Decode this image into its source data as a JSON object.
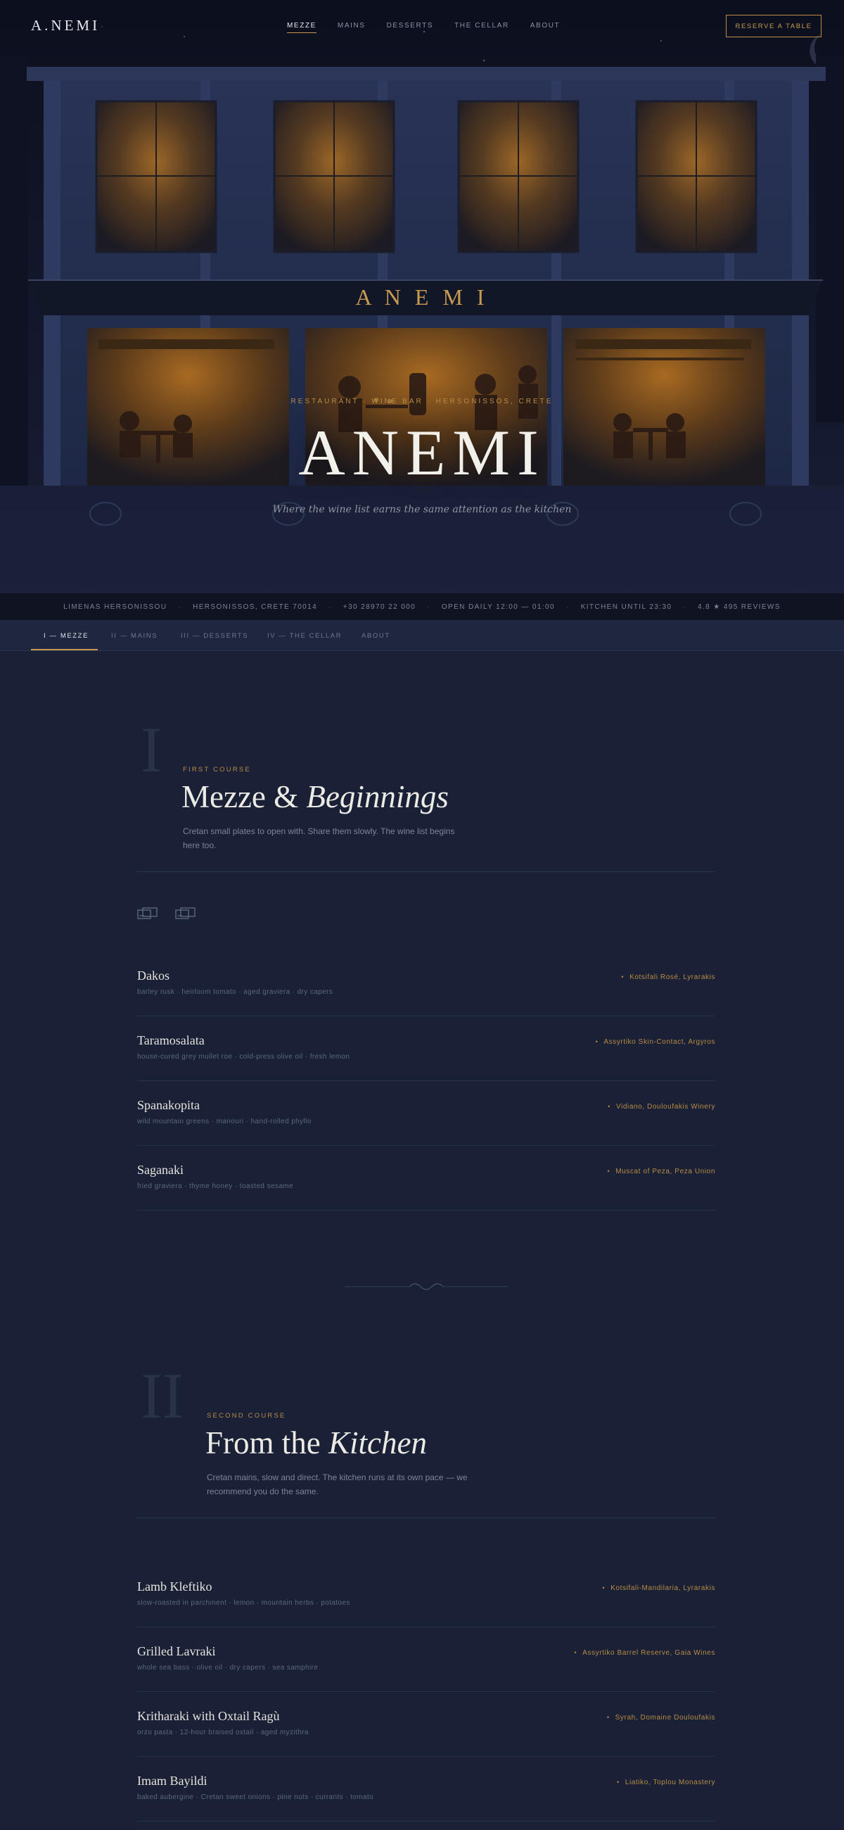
{
  "nav": {
    "logo": "A.NEMI",
    "links": [
      {
        "label": "MEZZE",
        "active": true
      },
      {
        "label": "MAINS",
        "active": false
      },
      {
        "label": "DESSERTS",
        "active": false
      },
      {
        "label": "THE CELLAR",
        "active": false
      },
      {
        "label": "ABOUT",
        "active": false
      }
    ],
    "reserve_label": "RESERVE A TABLE"
  },
  "hero": {
    "sign": "A N E M I",
    "tagline": "RESTAURANT · WINE BAR · HERSONISSOS, CRETE",
    "title": "ANEMI",
    "subtitle": "Where the wine list earns the same attention as the kitchen"
  },
  "info_bar": {
    "items": [
      "LIMENAS HERSONISSOU",
      "HERSONISSOS, CRETE 70014",
      "+30 28970 22 000",
      "OPEN DAILY 12:00 — 01:00",
      "KITCHEN UNTIL 23:30",
      "4.8 ★  495 REVIEWS"
    ]
  },
  "tabs": [
    {
      "label": "I — MEZZE",
      "active": true
    },
    {
      "label": "II — MAINS",
      "active": false
    },
    {
      "label": "III — DESSERTS",
      "active": false
    },
    {
      "label": "IV — THE CELLAR",
      "active": false
    },
    {
      "label": "ABOUT",
      "active": false
    }
  ],
  "sections": [
    {
      "numeral": "I",
      "eyebrow": "FIRST COURSE",
      "title_plain": "Mezze & ",
      "title_italic": "Beginnings",
      "description": "Cretan small plates to open with. Share them slowly. The wine list begins here too.",
      "icons": [
        "card-icon",
        "card-icon"
      ],
      "dishes": [
        {
          "name": "Dakos",
          "desc": "barley rusk · heirloom tomato · aged graviera · dry capers",
          "wine": "Kotsifali Rosé, Lyrarakis"
        },
        {
          "name": "Taramosalata",
          "desc": "house-cured grey mullet roe · cold-press olive oil · fresh lemon",
          "wine": "Assyrtiko Skin-Contact, Argyros"
        },
        {
          "name": "Spanakopita",
          "desc": "wild mountain greens · manouri · hand-rolled phyllo",
          "wine": "Vidiano, Douloufakis Winery"
        },
        {
          "name": "Saganaki",
          "desc": "fried graviera · thyme honey · toasted sesame",
          "wine": "Muscat of Peza, Peza Union"
        }
      ]
    },
    {
      "numeral": "II",
      "eyebrow": "SECOND COURSE",
      "title_plain": "From the ",
      "title_italic": "Kitchen",
      "description": "Cretan mains, slow and direct. The kitchen runs at its own pace — we recommend you do the same.",
      "dishes": [
        {
          "name": "Lamb Kleftiko",
          "desc": "slow-roasted in parchment · lemon · mountain herbs · potatoes",
          "wine": "Kotsifali-Mandilaria, Lyrarakis"
        },
        {
          "name": "Grilled Lavraki",
          "desc": "whole sea bass · olive oil · dry capers · sea samphire",
          "wine": "Assyrtiko Barrel Reserve, Gaia Wines"
        },
        {
          "name": "Kritharaki with Oxtail Ragù",
          "desc": "orzo pasta · 12-hour braised oxtail · aged myzithra",
          "wine": "Syrah, Domaine Douloufakis"
        },
        {
          "name": "Imam Bayildi",
          "desc": "baked aubergine · Cretan sweet onions · pine nuts · currants · tomato",
          "wine": "Liatiko, Toplou Monastery"
        }
      ]
    }
  ],
  "colors": {
    "accent": "#c89a50",
    "background": "#1a2035",
    "hero_dark": "#0c0f1d",
    "window_glow": "#b07020"
  }
}
